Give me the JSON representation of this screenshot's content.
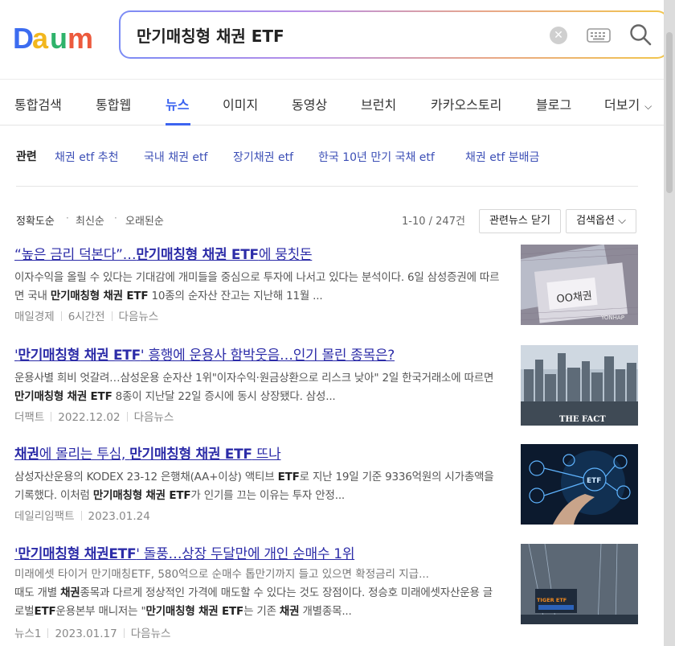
{
  "search": {
    "query": "만기매칭형 채권 ETF"
  },
  "tabs": [
    {
      "label": "통합검색"
    },
    {
      "label": "통합웹"
    },
    {
      "label": "뉴스"
    },
    {
      "label": "이미지"
    },
    {
      "label": "동영상"
    },
    {
      "label": "브런치"
    },
    {
      "label": "카카오스토리"
    },
    {
      "label": "블로그"
    },
    {
      "label": "더보기"
    }
  ],
  "related": {
    "label": "관련",
    "items": [
      "채권 etf 추천",
      "국내 채권 etf",
      "장기채권 etf",
      "한국 10년 만기 국채 etf",
      "채권 etf 분배금"
    ]
  },
  "sort": {
    "options": [
      "정확도순",
      "최신순",
      "오래된순"
    ],
    "count": "1-10 / 247건",
    "related_news_button": "관련뉴스 닫기",
    "search_options_button": "검색옵션"
  },
  "news": [
    {
      "title_pre": "“높은 금리 덕본다”…",
      "title_bold": "만기매칭형 채권 ETF",
      "title_post": "에 뭉칫돈",
      "desc_1": "이자수익을 올릴 수 있다는 기대감에 개미들을 중심으로 투자에 나서고 있다는 분석이다. 6일 삼성증권에 따르면 국내 ",
      "desc_bold": "만기매칭형 채권 ETF",
      "desc_2": " 10종의 순자산 잔고는 지난해 11월 ...",
      "source": "매일경제",
      "date": "6시간전",
      "via": "다음뉴스",
      "thumb_caption": "OO채권",
      "thumb_credit": "YONHAP"
    },
    {
      "title_pre": "'",
      "title_bold": "만기매칭형 채권 ETF",
      "title_post": "' 흥행에 운용사 함박웃음…인기 몰린 종목은?",
      "desc_1": "운용사별 희비 엇갈려…삼성운용 순자산 1위\"이자수익·원금상환으로 리스크 낮아\" 2일 한국거래소에 따르면 ",
      "desc_bold": "만기매칭형 채권 ETF",
      "desc_2": " 8종이 지난달 22일 증시에 동시 상장됐다. 삼성...",
      "source": "더팩트",
      "date": "2022.12.02",
      "via": "다음뉴스",
      "thumb_caption": "THE FACT"
    },
    {
      "title_pre": "",
      "title_bold": "채권",
      "title_mid": "에 몰리는 투심, ",
      "title_bold2": "만기매칭형 채권 ETF",
      "title_post": " 뜨나",
      "desc_1": "삼성자산운용의 KODEX 23-12 은행채(AA+이상) 액티브 ",
      "desc_bold": "ETF",
      "desc_2": "로 지난 19일 기준 9336억원의 시가총액을 기록했다. 이처럼 ",
      "desc_bold2": "만기매칭형 채권 ETF",
      "desc_3": "가 인기를 끄는 이유는 투자 안정...",
      "source": "데일리임팩트",
      "date": "2023.01.24",
      "thumb_caption": "ETF"
    },
    {
      "title_pre": "'",
      "title_bold": "만기매칭형 채권ETF",
      "title_post": "' 돌풍…상장 두달만에 개인 순매수 1위",
      "subline": "미래에셋 타이거 만기매칭ETF, 580억으로 순매수 톱만기까지 들고 있으면 확정금리 지급...",
      "desc_1": "때도 개별 ",
      "desc_bold": "채권",
      "desc_2": "종목과 다르게 정상적인 가격에 매도할 수 있다는 것도 장점이다. 정승호 미래에셋자산운용 글로벌",
      "desc_bold2": "ETF",
      "desc_3": "운용본부 매니저는 \"",
      "desc_bold3": "만기매칭형 채권 ETF",
      "desc_4": "는 기존 ",
      "desc_bold4": "채권",
      "desc_5": " 개별종목...",
      "source": "뉴스1",
      "date": "2023.01.17",
      "via": "다음뉴스",
      "thumb_caption": "TIGER ETF"
    }
  ]
}
